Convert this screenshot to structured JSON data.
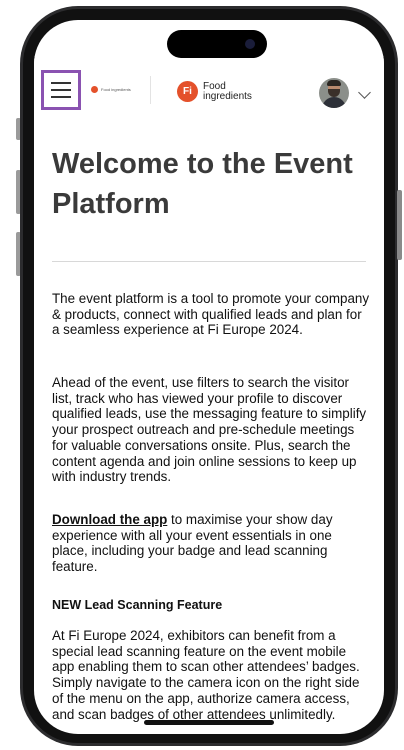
{
  "header": {
    "menu_icon": "hamburger-menu-icon",
    "small_logo_text": "Food ingredients",
    "logo_badge": "Fi",
    "logo_line1": "Food",
    "logo_line2": "ingredients",
    "brand_color": "#e4512b",
    "menu_highlight_color": "#8a52b1"
  },
  "main": {
    "title": "Welcome to the Event Platform",
    "paragraph1": "The event platform is a tool to promote your company & products, connect with qualified leads and plan for a seamless experience at Fi Europe 2024.",
    "paragraph2": "Ahead of the event, use filters to search the visitor list, track who has viewed your profile to discover qualified leads, use the messaging feature to simplify your prospect outreach and pre-schedule meetings for valuable conversations onsite. Plus, search the content agenda and join online sessions to keep up with industry trends.",
    "download_link": "Download the app",
    "paragraph3_rest": " to maximise your show day experience with all your event essentials in one place, including your badge and lead scanning feature.",
    "subheading": "NEW Lead Scanning Feature",
    "paragraph4": "At Fi Europe 2024, exhibitors can benefit from a special lead scanning feature on the event mobile app enabling them to scan other attendees’ badges. Simply navigate to the camera icon on the right side of the menu on the app, authorize camera access, and scan badges of other attendees unlimitedly."
  }
}
